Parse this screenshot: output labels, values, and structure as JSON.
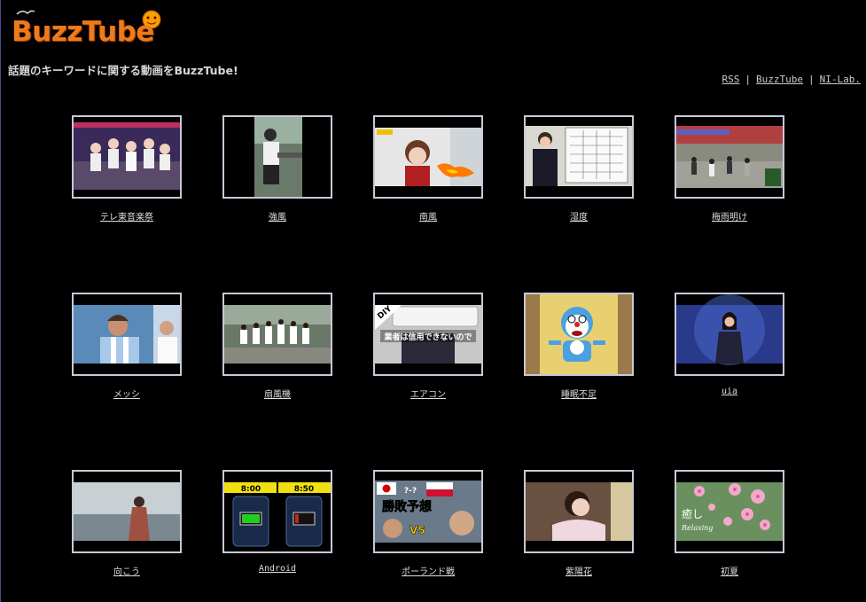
{
  "site": {
    "title": "BuzzTube",
    "tagline": "話題のキーワードに関する動画をBuzzTube!"
  },
  "top_links": [
    {
      "label": "RSS"
    },
    {
      "label": "BuzzTube"
    },
    {
      "label": "NI-Lab."
    }
  ],
  "top_links_separator": "|",
  "videos": [
    {
      "label": "テレ東音楽祭"
    },
    {
      "label": "強風"
    },
    {
      "label": "南風"
    },
    {
      "label": "湿度"
    },
    {
      "label": "梅雨明け"
    },
    {
      "label": "メッシ"
    },
    {
      "label": "扇風機"
    },
    {
      "label": "エアコン"
    },
    {
      "label": "睡眠不足"
    },
    {
      "label": "uia"
    },
    {
      "label": "向こう"
    },
    {
      "label": "Android"
    },
    {
      "label": "ポーランド戦"
    },
    {
      "label": "紫陽花"
    },
    {
      "label": "初夏"
    }
  ],
  "thumb_text": {
    "aircon_badge": "DIY",
    "aircon_caption": "業者は信用できないので",
    "android_time_left": "8:00",
    "android_time_right": "8:50",
    "poland_question": "?-?",
    "poland_title": "勝敗予想",
    "poland_vs": "VS",
    "shoka_title": "癒し",
    "shoka_sub": "Relaxing"
  }
}
